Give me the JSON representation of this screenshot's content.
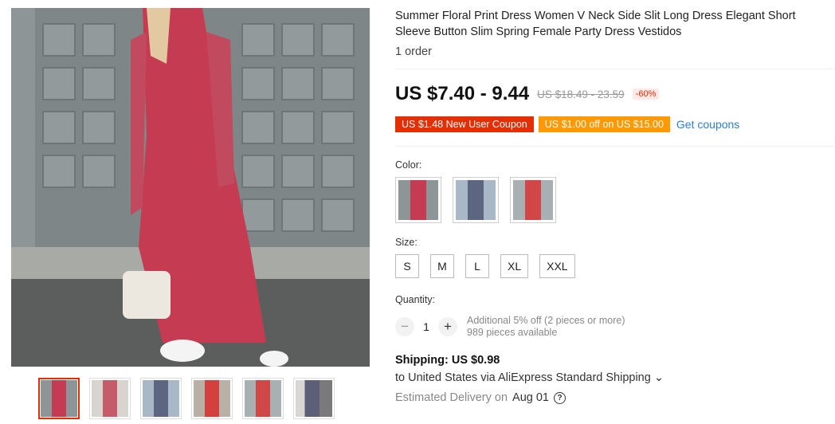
{
  "product": {
    "title": "Summer Floral Print Dress Women V Neck Side Slit Long Dress Elegant Short Sleeve Button Slim Spring Female Party Dress Vestidos",
    "orders": "1 order"
  },
  "price": {
    "current": "US $7.40 - 9.44",
    "original": "US $18.49 - 23.59",
    "discount": "-60%"
  },
  "coupons": {
    "new_user": "US $1.48 New User Coupon",
    "store": "US $1.00 off on US $15.00",
    "get_link": "Get coupons"
  },
  "color": {
    "label": "Color:"
  },
  "size": {
    "label": "Size:",
    "options": [
      "S",
      "M",
      "L",
      "XL",
      "XXL"
    ]
  },
  "quantity": {
    "label": "Quantity:",
    "minus": "−",
    "value": "1",
    "plus": "+",
    "promo": "Additional 5% off (2 pieces or more)",
    "available": "989 pieces available"
  },
  "shipping": {
    "cost": "Shipping: US $0.98",
    "to": "to United States via AliExpress Standard Shipping ⌄",
    "delivery_label": "Estimated Delivery on",
    "delivery_date": "Aug 01",
    "help_icon": "?"
  },
  "colors": {
    "accent": "#e62e04",
    "coupon_orange": "#ff9900",
    "link": "#2d7fcf"
  }
}
